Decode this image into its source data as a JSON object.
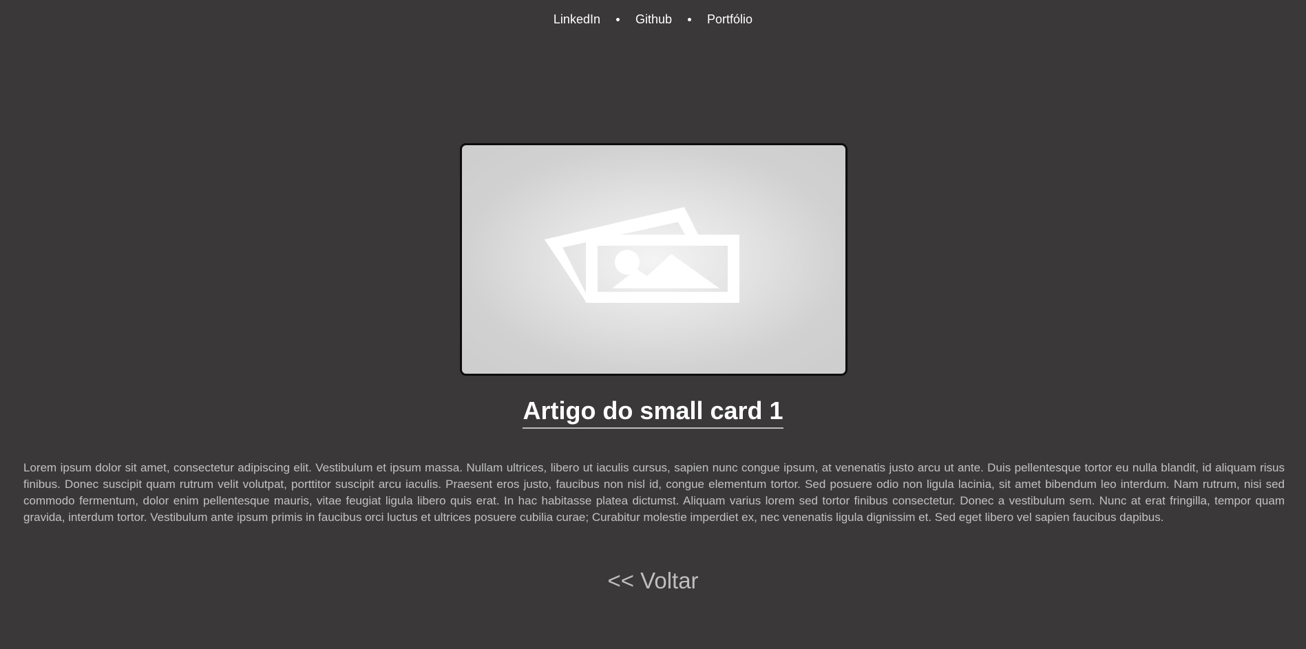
{
  "nav": {
    "links": [
      "LinkedIn",
      "Github",
      "Portfólio"
    ]
  },
  "image": {
    "icon": "image-placeholder-icon"
  },
  "article": {
    "title": "Artigo do small card 1",
    "body": "Lorem ipsum dolor sit amet, consectetur adipiscing elit. Vestibulum et ipsum massa. Nullam ultrices, libero ut iaculis cursus, sapien nunc congue ipsum, at venenatis justo arcu ut ante. Duis pellentesque tortor eu nulla blandit, id aliquam risus finibus. Donec suscipit quam rutrum velit volutpat, porttitor suscipit arcu iaculis. Praesent eros justo, faucibus non nisl id, congue elementum tortor. Sed posuere odio non ligula lacinia, sit amet bibendum leo interdum. Nam rutrum, nisi sed commodo fermentum, dolor enim pellentesque mauris, vitae feugiat ligula libero quis erat. In hac habitasse platea dictumst. Aliquam varius lorem sed tortor finibus consectetur. Donec a vestibulum sem. Nunc at erat fringilla, tempor quam gravida, interdum tortor. Vestibulum ante ipsum primis in faucibus orci luctus et ultrices posuere cubilia curae; Curabitur molestie imperdiet ex, nec venenatis ligula dignissim et. Sed eget libero vel sapien faucibus dapibus."
  },
  "back": {
    "label": "<< Voltar"
  },
  "colors": {
    "background": "#3a3839",
    "text_light": "#ffffff",
    "text_muted": "#c2c2c2"
  }
}
